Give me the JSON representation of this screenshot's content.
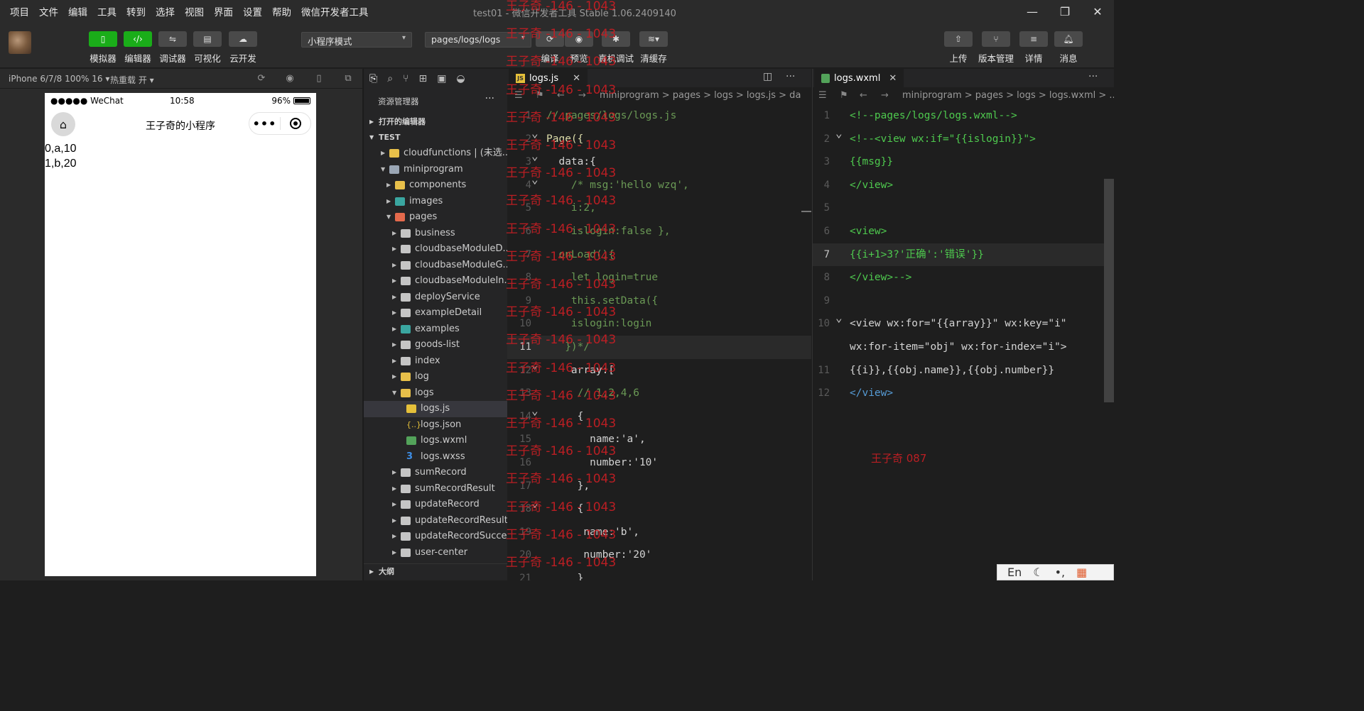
{
  "menu": [
    "项目",
    "文件",
    "编辑",
    "工具",
    "转到",
    "选择",
    "视图",
    "界面",
    "设置",
    "帮助",
    "微信开发者工具"
  ],
  "window_title": "test01 - 微信开发者工具 Stable 1.06.2409140",
  "toolbar": {
    "left_buttons": [
      {
        "label": "模拟器",
        "icon": "phone-icon"
      },
      {
        "label": "编辑器",
        "icon": "code-icon"
      },
      {
        "label": "调试器",
        "icon": "debug-icon"
      },
      {
        "label": "可视化",
        "icon": "layout-icon"
      },
      {
        "label": "云开发",
        "icon": "cloud-icon"
      }
    ],
    "mode_select": "小程序模式",
    "page_select": "pages/logs/logs",
    "action_buttons": [
      {
        "label": "编译",
        "icon": "refresh-icon"
      },
      {
        "label": "预览",
        "icon": "eye-icon"
      },
      {
        "label": "真机调试",
        "icon": "bug-icon"
      },
      {
        "label": "清缓存",
        "icon": "layers-icon"
      }
    ],
    "right_buttons": [
      {
        "label": "上传",
        "icon": "upload-icon"
      },
      {
        "label": "版本管理",
        "icon": "branch-icon"
      },
      {
        "label": "详情",
        "icon": "menu-icon"
      },
      {
        "label": "消息",
        "icon": "bell-icon"
      }
    ]
  },
  "simulator": {
    "device": "iPhone 6/7/8 100% 16 ▾",
    "hot_reload": "热重载 开 ▾",
    "status": {
      "carrier": "●●●●● WeChat",
      "time": "10:58",
      "battery": "96%"
    },
    "nav_title": "王子奇的小程序",
    "content_lines": [
      "0,a,10",
      "1,b,20"
    ]
  },
  "explorer": {
    "title": "资源管理器",
    "open_editors": "打开的编辑器",
    "project": "TEST",
    "outline": "大纲",
    "tree": [
      {
        "label": "cloudfunctions | (未选...",
        "depth": 0,
        "open": false,
        "icon": "folder-y"
      },
      {
        "label": "miniprogram",
        "depth": 0,
        "open": true,
        "icon": "folder-b"
      },
      {
        "label": "components",
        "depth": 1,
        "open": false,
        "icon": "folder-y"
      },
      {
        "label": "images",
        "depth": 1,
        "open": false,
        "icon": "folder-t"
      },
      {
        "label": "pages",
        "depth": 1,
        "open": true,
        "icon": "folder-r"
      },
      {
        "label": "business",
        "depth": 2,
        "open": false,
        "icon": "folder"
      },
      {
        "label": "cloudbaseModuleD...",
        "depth": 2,
        "open": false,
        "icon": "folder"
      },
      {
        "label": "cloudbaseModuleG...",
        "depth": 2,
        "open": false,
        "icon": "folder"
      },
      {
        "label": "cloudbaseModuleIn...",
        "depth": 2,
        "open": false,
        "icon": "folder"
      },
      {
        "label": "deployService",
        "depth": 2,
        "open": false,
        "icon": "folder"
      },
      {
        "label": "exampleDetail",
        "depth": 2,
        "open": false,
        "icon": "folder"
      },
      {
        "label": "examples",
        "depth": 2,
        "open": false,
        "icon": "folder-t"
      },
      {
        "label": "goods-list",
        "depth": 2,
        "open": false,
        "icon": "folder"
      },
      {
        "label": "index",
        "depth": 2,
        "open": false,
        "icon": "folder"
      },
      {
        "label": "log",
        "depth": 2,
        "open": false,
        "icon": "folder-y"
      },
      {
        "label": "logs",
        "depth": 2,
        "open": true,
        "icon": "folder-y"
      },
      {
        "label": "logs.js",
        "depth": 3,
        "file": true,
        "icon": "js",
        "selected": true
      },
      {
        "label": "logs.json",
        "depth": 3,
        "file": true,
        "icon": "json"
      },
      {
        "label": "logs.wxml",
        "depth": 3,
        "file": true,
        "icon": "wxml"
      },
      {
        "label": "logs.wxss",
        "depth": 3,
        "file": true,
        "icon": "wxss"
      },
      {
        "label": "sumRecord",
        "depth": 2,
        "open": false,
        "icon": "folder"
      },
      {
        "label": "sumRecordResult",
        "depth": 2,
        "open": false,
        "icon": "folder"
      },
      {
        "label": "updateRecord",
        "depth": 2,
        "open": false,
        "icon": "folder"
      },
      {
        "label": "updateRecordResult",
        "depth": 2,
        "open": false,
        "icon": "folder"
      },
      {
        "label": "updateRecordSuccess",
        "depth": 2,
        "open": false,
        "icon": "folder"
      },
      {
        "label": "user-center",
        "depth": 2,
        "open": false,
        "icon": "folder"
      }
    ]
  },
  "editor_js": {
    "tab": "logs.js",
    "breadcrumb": "miniprogram > pages > logs > logs.js > da",
    "lines": [
      {
        "n": "1",
        "text": "// pages/logs/logs.js",
        "cls": "c-com"
      },
      {
        "n": "2",
        "text": "Page({",
        "cls": "c-fn",
        "fold": true
      },
      {
        "n": "3",
        "text": "  data:{",
        "cls": "c-txt",
        "fold": true
      },
      {
        "n": "4",
        "text": "    /* msg:'hello wzq',",
        "cls": "c-com",
        "fold": true
      },
      {
        "n": "5",
        "text": "    i:2,",
        "cls": "c-com"
      },
      {
        "n": "6",
        "text": "    islogin:false },",
        "cls": "c-com"
      },
      {
        "n": "7",
        "text": "  onLoad(){",
        "cls": "c-com"
      },
      {
        "n": "8",
        "text": "    let login=true",
        "cls": "c-com"
      },
      {
        "n": "9",
        "text": "    this.setData({",
        "cls": "c-com"
      },
      {
        "n": "10",
        "text": "    islogin:login",
        "cls": "c-com"
      },
      {
        "n": "11",
        "text": "   })*/",
        "cls": "c-com",
        "current": true
      },
      {
        "n": "12",
        "text": "    array:[",
        "cls": "c-txt",
        "fold": true
      },
      {
        "n": "13",
        "text": "     // 1,2,4,6",
        "cls": "c-com"
      },
      {
        "n": "14",
        "text": "     {",
        "cls": "c-txt",
        "fold": true
      },
      {
        "n": "15",
        "text": "       name:'a',",
        "cls": "c-txt"
      },
      {
        "n": "16",
        "text": "       number:'10'",
        "cls": "c-txt"
      },
      {
        "n": "17",
        "text": "     },",
        "cls": "c-txt"
      },
      {
        "n": "18",
        "text": "     {",
        "cls": "c-txt",
        "fold": true
      },
      {
        "n": "19",
        "text": "      name:'b',",
        "cls": "c-txt"
      },
      {
        "n": "20",
        "text": "      number:'20'",
        "cls": "c-txt"
      },
      {
        "n": "21",
        "text": "     }",
        "cls": "c-txt"
      }
    ]
  },
  "editor_wxml": {
    "tab": "logs.wxml",
    "breadcrumb": "miniprogram > pages > logs > logs.wxml > ...",
    "lines": [
      {
        "n": "1",
        "text": "<!--pages/logs/logs.wxml-->",
        "cls": "c-grn"
      },
      {
        "n": "2",
        "text": "<!--<view wx:if=\"{{islogin}}\">",
        "cls": "c-grn",
        "fold": true
      },
      {
        "n": "3",
        "text": "{{msg}}",
        "cls": "c-grn"
      },
      {
        "n": "4",
        "text": "</view>",
        "cls": "c-grn"
      },
      {
        "n": "5",
        "text": "",
        "cls": "c-grn"
      },
      {
        "n": "6",
        "text": "<view>",
        "cls": "c-grn"
      },
      {
        "n": "7",
        "text": "{{i+1>3?'正确':'错误'}}",
        "cls": "c-grn",
        "current": true
      },
      {
        "n": "8",
        "text": "</view>-->",
        "cls": "c-grn"
      },
      {
        "n": "9",
        "text": "",
        "cls": "c-grn"
      },
      {
        "n": "10",
        "text": "<view wx:for=\"{{array}}\" wx:key=\"i\"",
        "cls": "c-txt",
        "fold": true
      },
      {
        "n": "",
        "text": "wx:for-item=\"obj\" wx:for-index=\"i\">",
        "cls": "c-txt"
      },
      {
        "n": "11",
        "text": "{{i}},{{obj.name}},{{obj.number}}",
        "cls": "c-txt"
      },
      {
        "n": "12",
        "text": "</view>",
        "cls": "c-tag"
      }
    ],
    "watermark": "王子奇 087"
  },
  "watermark_repeat": "王子奇 -146 - 1043",
  "ime": {
    "lang": "En",
    "moon": "☾",
    "punct": "•,",
    "apps": "▦"
  },
  "colors": {
    "accent_green": "#1aad19",
    "watermark_red": "#c41e24"
  }
}
